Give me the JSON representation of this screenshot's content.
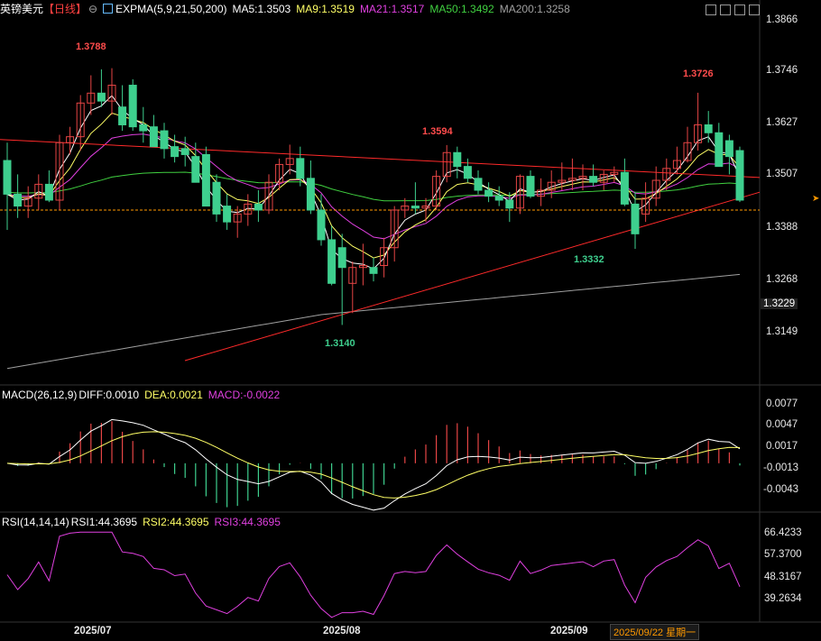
{
  "header": {
    "instrument": "英镑美元",
    "period": "【日线】",
    "icon_settings": "settings-icon",
    "indicator_icon": "chart-indicator-icon",
    "expma_label": "EXPMA(5,9,21,50,200)",
    "ma5": "MA5:1.3503",
    "ma9": "MA9:1.3519",
    "ma21": "MA21:1.3517",
    "ma50": "MA50:1.3492",
    "ma200": "MA200:1.3258"
  },
  "macd_header": {
    "label": "MACD(26,12,9)",
    "diff": "DIFF:0.0010",
    "dea": "DEA:0.0021",
    "macd": "MACD:-0.0022"
  },
  "rsi_header": {
    "label": "RSI(14,14,14)",
    "rsi1": "RSI1:44.3695",
    "rsi2": "RSI2:44.3695",
    "rsi3": "RSI3:44.3695"
  },
  "annotations": {
    "high1": "1.3788",
    "high2": "1.3594",
    "high3": "1.3726",
    "low1": "1.3140",
    "low2": "1.3332"
  },
  "price_axis": [
    "1.3866",
    "1.3746",
    "1.3627",
    "1.3507",
    "1.3388",
    "1.3268",
    "1.3149"
  ],
  "current_price_label": "1.3229",
  "macd_axis": [
    "0.0077",
    "0.0047",
    "0.0017",
    "-0.0013",
    "-0.0043"
  ],
  "rsi_axis": [
    "66.4233",
    "57.3700",
    "48.3167",
    "39.2634"
  ],
  "date_axis": [
    "2025/07",
    "2025/08",
    "2025/09"
  ],
  "cursor_date": "2025/09/22 星期一",
  "colors": {
    "up": "#e64545",
    "down": "#3ecf8e",
    "ma5": "#ffffff",
    "ma9": "#ffff66",
    "ma21": "#e040e0",
    "ma50": "#40d040",
    "ma200": "#a0a0a0",
    "trend": "#ff2a2a",
    "hline": "#ff9900"
  },
  "chart_data": [
    {
      "type": "candlestick",
      "title": "英镑美元【日线】",
      "x": [
        "2025-06-16",
        "2025-06-17",
        "2025-06-18",
        "2025-06-19",
        "2025-06-20",
        "2025-06-23",
        "2025-06-24",
        "2025-06-25",
        "2025-06-26",
        "2025-06-27",
        "2025-06-30",
        "2025-07-01",
        "2025-07-02",
        "2025-07-03",
        "2025-07-04",
        "2025-07-07",
        "2025-07-08",
        "2025-07-09",
        "2025-07-10",
        "2025-07-11",
        "2025-07-14",
        "2025-07-15",
        "2025-07-16",
        "2025-07-17",
        "2025-07-18",
        "2025-07-21",
        "2025-07-22",
        "2025-07-23",
        "2025-07-24",
        "2025-07-25",
        "2025-07-28",
        "2025-07-29",
        "2025-07-30",
        "2025-07-31",
        "2025-08-01",
        "2025-08-04",
        "2025-08-05",
        "2025-08-06",
        "2025-08-07",
        "2025-08-08",
        "2025-08-11",
        "2025-08-12",
        "2025-08-13",
        "2025-08-14",
        "2025-08-15",
        "2025-08-18",
        "2025-08-19",
        "2025-08-20",
        "2025-08-21",
        "2025-08-22",
        "2025-08-25",
        "2025-08-26",
        "2025-08-27",
        "2025-08-28",
        "2025-08-29",
        "2025-09-01",
        "2025-09-02",
        "2025-09-03",
        "2025-09-04",
        "2025-09-05",
        "2025-09-08",
        "2025-09-09",
        "2025-09-10",
        "2025-09-11",
        "2025-09-12",
        "2025-09-15",
        "2025-09-16",
        "2025-09-17",
        "2025-09-18",
        "2025-09-19",
        "2025-09-22"
      ],
      "open": [
        1.3555,
        1.347,
        1.344,
        1.346,
        1.3495,
        1.3455,
        1.36,
        1.3615,
        1.37,
        1.3725,
        1.3705,
        1.369,
        1.3745,
        1.3645,
        1.364,
        1.363,
        1.359,
        1.3585,
        1.3565,
        1.357,
        1.35,
        1.344,
        1.34,
        1.342,
        1.3445,
        1.343,
        1.35,
        1.3545,
        1.356,
        1.351,
        1.343,
        1.3355,
        1.3335,
        1.3245,
        1.3285,
        1.3285,
        1.329,
        1.3335,
        1.343,
        1.344,
        1.3435,
        1.344,
        1.3515,
        1.3575,
        1.354,
        1.351,
        1.348,
        1.3465,
        1.3455,
        1.3435,
        1.3515,
        1.3465,
        1.348,
        1.35,
        1.3505,
        1.351,
        1.3515,
        1.35,
        1.352,
        1.3525,
        1.3445,
        1.342,
        1.346,
        1.3505,
        1.3535,
        1.3555,
        1.36,
        1.3645,
        1.3625,
        1.3605,
        1.358
      ],
      "high": [
        1.36,
        1.352,
        1.349,
        1.352,
        1.353,
        1.362,
        1.364,
        1.372,
        1.377,
        1.3785,
        1.3788,
        1.3745,
        1.376,
        1.369,
        1.367,
        1.365,
        1.362,
        1.3615,
        1.36,
        1.359,
        1.352,
        1.347,
        1.344,
        1.347,
        1.348,
        1.352,
        1.356,
        1.3595,
        1.359,
        1.3555,
        1.347,
        1.339,
        1.337,
        1.33,
        1.3345,
        1.331,
        1.336,
        1.344,
        1.346,
        1.35,
        1.346,
        1.353,
        1.3594,
        1.359,
        1.356,
        1.353,
        1.35,
        1.349,
        1.3475,
        1.352,
        1.353,
        1.351,
        1.353,
        1.355,
        1.356,
        1.3545,
        1.3545,
        1.353,
        1.354,
        1.356,
        1.3475,
        1.35,
        1.354,
        1.356,
        1.359,
        1.364,
        1.3726,
        1.368,
        1.365,
        1.362,
        1.359
      ],
      "low": [
        1.338,
        1.341,
        1.341,
        1.343,
        1.345,
        1.343,
        1.357,
        1.358,
        1.367,
        1.369,
        1.367,
        1.363,
        1.363,
        1.36,
        1.361,
        1.356,
        1.355,
        1.354,
        1.352,
        1.348,
        1.34,
        1.338,
        1.336,
        1.339,
        1.34,
        1.342,
        1.348,
        1.352,
        1.349,
        1.342,
        1.334,
        1.324,
        1.314,
        1.317,
        1.324,
        1.325,
        1.326,
        1.33,
        1.341,
        1.342,
        1.34,
        1.343,
        1.35,
        1.351,
        1.35,
        1.347,
        1.345,
        1.344,
        1.34,
        1.342,
        1.346,
        1.344,
        1.346,
        1.348,
        1.348,
        1.348,
        1.349,
        1.348,
        1.35,
        1.344,
        1.3332,
        1.34,
        1.344,
        1.348,
        1.352,
        1.355,
        1.358,
        1.36,
        1.356,
        1.352,
        1.345
      ],
      "close": [
        1.347,
        1.344,
        1.346,
        1.3495,
        1.3455,
        1.36,
        1.3615,
        1.37,
        1.3725,
        1.3705,
        1.3745,
        1.3645,
        1.364,
        1.363,
        1.359,
        1.3585,
        1.3565,
        1.357,
        1.35,
        1.344,
        1.342,
        1.34,
        1.342,
        1.3445,
        1.343,
        1.35,
        1.3545,
        1.356,
        1.351,
        1.343,
        1.3355,
        1.3245,
        1.3285,
        1.3285,
        1.329,
        1.327,
        1.3335,
        1.343,
        1.344,
        1.3435,
        1.344,
        1.3515,
        1.3575,
        1.354,
        1.351,
        1.348,
        1.3465,
        1.3455,
        1.3435,
        1.3515,
        1.3465,
        1.348,
        1.35,
        1.3505,
        1.351,
        1.3515,
        1.35,
        1.352,
        1.3525,
        1.3445,
        1.337,
        1.346,
        1.3505,
        1.3535,
        1.3555,
        1.36,
        1.3645,
        1.3625,
        1.354,
        1.3565,
        1.3455
      ]
    },
    {
      "type": "line",
      "title": "MACD(26,12,9)",
      "series": [
        {
          "name": "DIFF"
        },
        {
          "name": "DEA"
        },
        {
          "name": "MACD"
        }
      ],
      "ylim": [
        -0.006,
        0.0085
      ]
    },
    {
      "type": "line",
      "title": "RSI(14,14,14)",
      "series": [
        {
          "name": "RSI1"
        },
        {
          "name": "RSI2"
        },
        {
          "name": "RSI3"
        }
      ],
      "ylim": [
        30,
        70
      ]
    }
  ]
}
